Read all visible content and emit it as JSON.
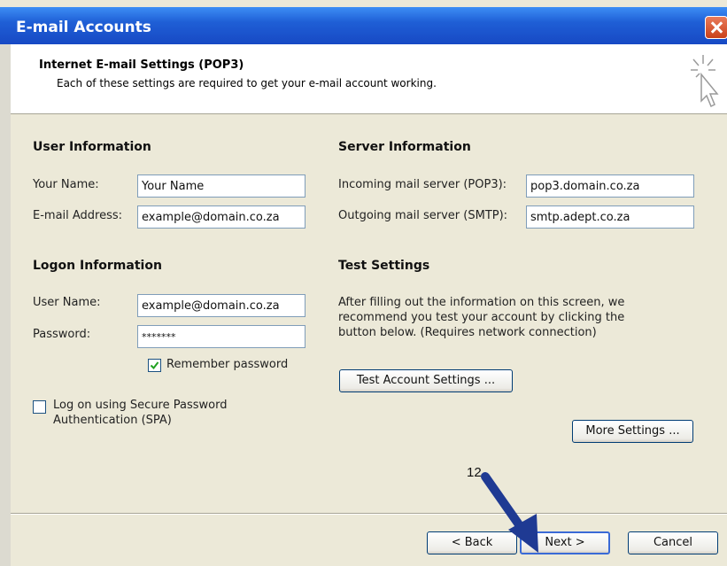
{
  "window": {
    "title": "E-mail Accounts"
  },
  "header": {
    "title": "Internet E-mail Settings (POP3)",
    "subtitle": "Each of these settings are required to get your e-mail account working."
  },
  "user_info": {
    "heading": "User Information",
    "name_label": "Your Name:",
    "name_value": "Your Name",
    "email_label": "E-mail Address:",
    "email_value": "example@domain.co.za"
  },
  "logon_info": {
    "heading": "Logon Information",
    "username_label": "User Name:",
    "username_value": "example@domain.co.za",
    "password_label": "Password:",
    "password_value": "*******",
    "remember_label": "Remember password",
    "remember_checked": true,
    "spa_label_line1": "Log on using Secure Password",
    "spa_label_line2": "Authentication (SPA)",
    "spa_checked": false
  },
  "server_info": {
    "heading": "Server Information",
    "incoming_label": "Incoming mail server (POP3):",
    "incoming_value": "pop3.domain.co.za",
    "outgoing_label": "Outgoing mail server (SMTP):",
    "outgoing_value": "smtp.adept.co.za"
  },
  "test_settings": {
    "heading": "Test Settings",
    "line1": "After filling out the information on this screen, we",
    "line2": "recommend you test your account by clicking the",
    "line3": "button below. (Requires network connection)",
    "test_button": "Test Account Settings ...",
    "more_button": "More Settings ..."
  },
  "footer": {
    "back_button": "< Back",
    "next_button": "Next >",
    "cancel_button": "Cancel"
  },
  "annotation": {
    "step": "12",
    "arrow_color": "#1f3a93"
  }
}
